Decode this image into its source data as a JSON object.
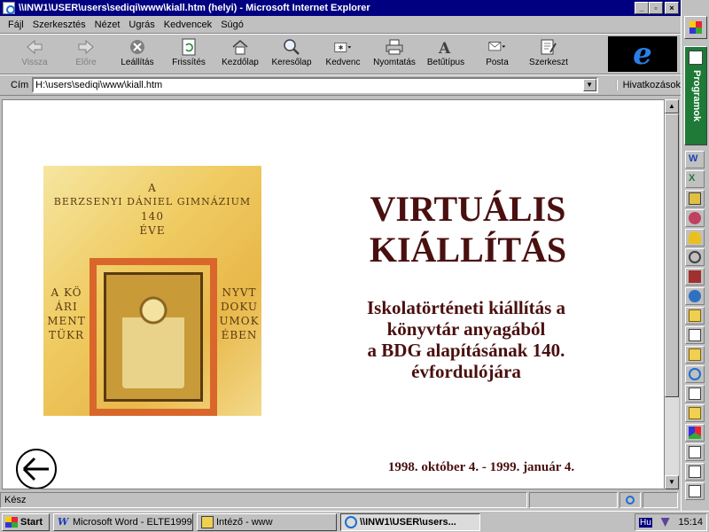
{
  "window": {
    "title": "\\\\INW1\\USER\\users\\sediqi\\www\\kiall.htm (helyi) - Microsoft Internet Explorer",
    "min_label": "_",
    "max_label": "▫",
    "close_label": "×"
  },
  "menu": [
    {
      "label": "Fájl"
    },
    {
      "label": "Szerkesztés"
    },
    {
      "label": "Nézet"
    },
    {
      "label": "Ugrás"
    },
    {
      "label": "Kedvencek"
    },
    {
      "label": "Súgó"
    }
  ],
  "toolbar": {
    "back": "Vissza",
    "forward": "Előre",
    "stop": "Leállítás",
    "refresh": "Frissítés",
    "home": "Kezdőlap",
    "search": "Keresőlap",
    "favorites": "Kedvenc",
    "print": "Nyomtatás",
    "font": "Betűtípus",
    "mail": "Posta",
    "edit": "Szerkeszt"
  },
  "address": {
    "label": "Cím",
    "value": "H:\\users\\sediqi\\www\\kiall.htm",
    "links_label": "Hivatkozások"
  },
  "page": {
    "title_line1": "VIRTUÁLIS",
    "title_line2": "KIÁLLÍTÁS",
    "subtitle_line1": "Iskolatörténeti kiállítás a",
    "subtitle_line2": "könyvtár anyagából",
    "subtitle_line3": "a BDG alapításának 140.",
    "subtitle_line4": "évfordulójára",
    "date": "1998. október  4. - 1999. január 4.",
    "manuscript": {
      "line1": "A",
      "line2": "BERZSENYI DÁNIEL GIMNÁZIUM",
      "line3": "140",
      "line4": "ÉVE",
      "left1": "A KÖ",
      "left2": "ÁRI",
      "left3": "MENT",
      "left4": "TÜKR",
      "right1": "NYVT",
      "right2": "DOKU",
      "right3": "UMOK",
      "right4": "ÉBEN"
    }
  },
  "status": {
    "text": "Kész"
  },
  "officebar": {
    "programs_label": "Programok"
  },
  "taskbar": {
    "start_label": "Start",
    "tasks": [
      {
        "label": "Microsoft Word - ELTE1999"
      },
      {
        "label": "Intéző - www"
      },
      {
        "label": "\\\\INW1\\USER\\users..."
      }
    ],
    "lang": "Hu",
    "clock": "15:14"
  },
  "colors": {
    "title_bar": "#000080",
    "page_text": "#4a0f0f",
    "office_programs": "#1e7a36"
  }
}
